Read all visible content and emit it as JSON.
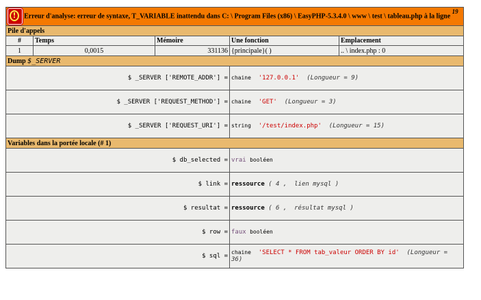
{
  "error": {
    "message": "Erreur d'analyse: erreur de syntaxe, T_VARIABLE inattendu dans C: \\ Program Files (x86) \\ EasyPHP-5.3.4.0 \\ www \\ test \\ tableau.php à la ligne",
    "line": "19",
    "icon": "error-icon"
  },
  "callstack": {
    "title": "Pile d'appels",
    "headers": [
      "#",
      "Temps",
      "Mémoire",
      "Une fonction",
      "Emplacement"
    ],
    "rows": [
      {
        "index": "1",
        "time": "0,0015",
        "memory": "331136",
        "function": "{principale}( )",
        "location": ".. \\ index.php : 0"
      }
    ]
  },
  "dump": {
    "title": "Dump",
    "var": "$_SERVER",
    "rows": [
      {
        "name": "$ _SERVER ['REMOTE_ADDR'] =",
        "type": "chaine",
        "value": "'127.0.0.1'",
        "length": "(Longueur = 9)"
      },
      {
        "name": "$ _SERVER ['REQUEST_METHOD'] =",
        "type": "chaine",
        "value": "'GET'",
        "length": "(Longueur = 3)"
      },
      {
        "name": "$ _SERVER ['REQUEST_URI'] =",
        "type": "string",
        "value": "'/test/index.php'",
        "length": "(Longueur = 15)"
      }
    ]
  },
  "locals": {
    "title": "Variables dans la portée locale (# 1)",
    "db_selected": {
      "name": "$ db_selected =",
      "value": "vrai",
      "type": "booléen"
    },
    "link": {
      "name": "$ link =",
      "kind": "ressource",
      "open": "( 4 ,",
      "detail": "lien mysql",
      "close": ")"
    },
    "resultat": {
      "name": "$ resultat =",
      "kind": "ressource",
      "open": "( 6 ,",
      "detail": "résultat mysql",
      "close": ")"
    },
    "row": {
      "name": "$ row =",
      "value": "faux",
      "type": "booléen"
    },
    "sql": {
      "name": "$ sql =",
      "type": "chaine",
      "value": "'SELECT * FROM tab_valeur ORDER BY id'",
      "length": "(Longueur = 36)"
    }
  },
  "colors": {
    "error_header": "#f57900",
    "section_header": "#e9b96e",
    "cell_bg": "#eeeeec",
    "string": "#cc0000",
    "bool": "#75507b"
  }
}
